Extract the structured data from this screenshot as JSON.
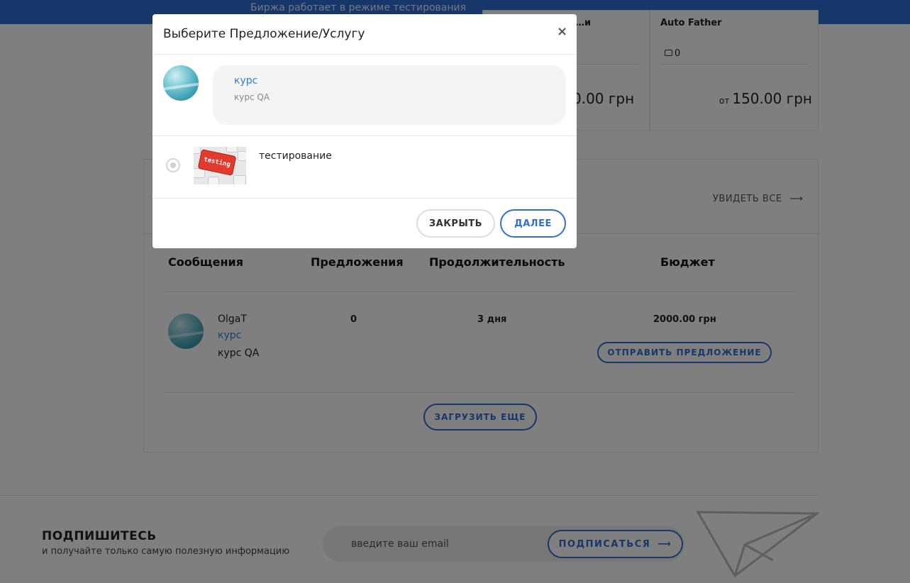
{
  "banner": {
    "text": "Биржа работает в режиме тестирования"
  },
  "cards": {
    "card1_title_partial": "…и",
    "card1_price": "0.00 грн",
    "card2_title": "Auto Father",
    "card2_comments": "0",
    "card2_price_prefix": "от",
    "card2_price": "150.00 грн"
  },
  "section": {
    "see_all": "УВИДЕТЬ ВСЕ"
  },
  "table": {
    "headers": [
      "Сообщения",
      "Предложения",
      "Продолжительность",
      "Бюджет"
    ],
    "row": {
      "user": "OlgaT",
      "course_link": "курс",
      "course_desc": "курс QA",
      "proposals": "0",
      "duration": "3 дня",
      "budget": "2000.00 грн",
      "action": "ОТПРАВИТЬ ПРЕДЛОЖЕНИЕ"
    },
    "load_more": "ЗАГРУЗИТЬ ЕЩЕ"
  },
  "modal": {
    "title": "Выберите Предложение/Услугу",
    "close_symbol": "×",
    "order_link": "курс",
    "order_desc": "курс QA",
    "service_label": "тестирование",
    "thumb_text": "testing",
    "btn_close": "ЗАКРЫТЬ",
    "btn_next": "ДАЛЕЕ"
  },
  "footer": {
    "title": "ПОДПИШИТЕСЬ",
    "subtitle": "и получайте только самую полезную информацию",
    "email_placeholder": "введите ваш email",
    "subscribe": "ПОДПИСАТЬСЯ"
  },
  "colors": {
    "accent": "#2f6fd6",
    "link": "#2f7fd0",
    "overlay": "rgba(0,0,0,0.5)"
  }
}
